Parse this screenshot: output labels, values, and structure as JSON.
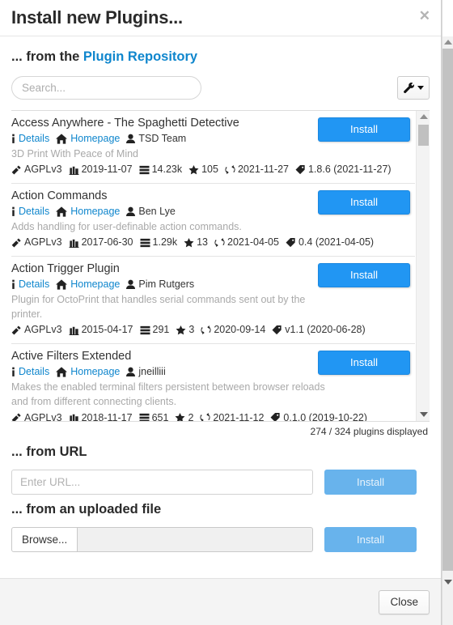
{
  "modal": {
    "title": "Install new Plugins...",
    "close_icon": "close-icon",
    "footer_close_label": "Close"
  },
  "repository": {
    "heading_prefix": "... from the ",
    "heading_link": "Plugin Repository",
    "search": {
      "placeholder": "Search...",
      "value": ""
    },
    "options_button": {
      "icon": "wrench-icon",
      "caret": "caret-down-icon"
    },
    "install_label": "Install",
    "details_label": "Details",
    "homepage_label": "Homepage",
    "count_text": "274 / 324 plugins displayed",
    "plugins": [
      {
        "name": "Access Anywhere - The Spaghetti Detective",
        "author": "TSD Team",
        "description": "3D Print With Peace of Mind",
        "license": "AGPLv3",
        "published": "2019-11-07",
        "downloads": "14.23k",
        "stars": "105",
        "updated": "2021-11-27",
        "version": "1.8.6 (2021-11-27)"
      },
      {
        "name": "Action Commands",
        "author": "Ben Lye",
        "description": "Adds handling for user-definable action commands.",
        "license": "AGPLv3",
        "published": "2017-06-30",
        "downloads": "1.29k",
        "stars": "13",
        "updated": "2021-04-05",
        "version": "0.4 (2021-04-05)"
      },
      {
        "name": "Action Trigger Plugin",
        "author": "Pim Rutgers",
        "description": "Plugin for OctoPrint that handles serial commands sent out by the printer.",
        "license": "AGPLv3",
        "published": "2015-04-17",
        "downloads": "291",
        "stars": "3",
        "updated": "2020-09-14",
        "version": "v1.1 (2020-06-28)"
      },
      {
        "name": "Active Filters Extended",
        "author": "jneilliii",
        "description": "Makes the enabled terminal filters persistent between browser reloads and from different connecting clients.",
        "license": "AGPLv3",
        "published": "2018-11-17",
        "downloads": "651",
        "stars": "2",
        "updated": "2021-11-12",
        "version": "0.1.0 (2019-10-22)"
      }
    ]
  },
  "from_url": {
    "heading": "... from URL",
    "input_placeholder": "Enter URL...",
    "input_value": "",
    "install_label": "Install"
  },
  "from_file": {
    "heading": "... from an uploaded file",
    "browse_label": "Browse...",
    "file_value": "",
    "install_label": "Install"
  },
  "colors": {
    "accent_blue": "#2196f3",
    "link_blue": "#0f86cd",
    "disabled_blue": "#68b3ec",
    "muted_text": "#a9a9a9"
  }
}
